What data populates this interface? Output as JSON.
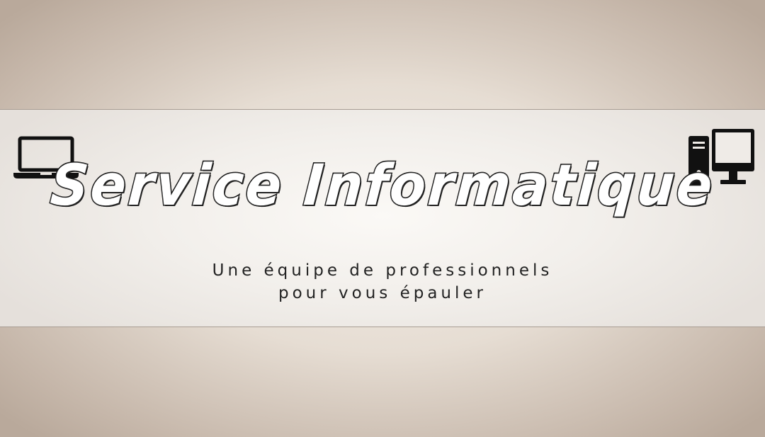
{
  "banner": {
    "title": "Service Informatique",
    "subtitle_line1": "Une équipe de professionnels",
    "subtitle_line2": "pour vous épauler"
  },
  "icons": {
    "left": "laptop-icon",
    "right": "desktop-computer-icon"
  },
  "colors": {
    "text": "#111111",
    "background_outer": "#c6b7aa",
    "background_band": "#f2efeb"
  }
}
